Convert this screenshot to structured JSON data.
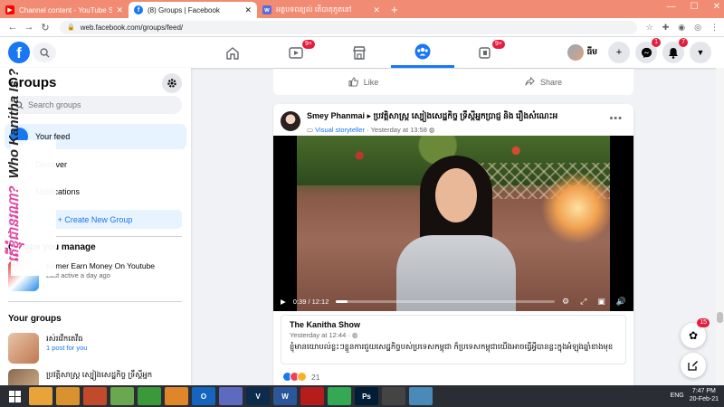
{
  "browser": {
    "tabs": [
      {
        "title": "Channel content - YouTube Studio",
        "fav_color": "#ff0000",
        "fav_glyph": "▶",
        "active": false
      },
      {
        "title": "(8) Groups | Facebook",
        "fav_color": "#1877f2",
        "fav_glyph": "f",
        "active": true
      },
      {
        "title": "អត្ថបទពន្យល់ តើបាតុភូតនៅ",
        "fav_color": "#5b6bd8",
        "fav_glyph": "w",
        "active": false
      }
    ],
    "new_tab": "+",
    "url": "web.facebook.com/groups/feed/"
  },
  "fbnav": {
    "logo": "f",
    "watch_badge": "9+",
    "gaming_badge": "9+",
    "profile_name": "ធីម",
    "messenger_badge": "1",
    "notifications_badge": "7"
  },
  "sidebar": {
    "title": "Groups",
    "search_placeholder": "Search groups",
    "items": [
      {
        "label": "Your feed",
        "active": true
      },
      {
        "label": "Discover",
        "active": false
      },
      {
        "label": "Notifications",
        "active": false
      }
    ],
    "create_label": "+ Create New Group",
    "manage_heading": "Groups you manage",
    "managed_group": {
      "name": "Khmer Earn Money On Youtube",
      "sub": "Last active a day ago"
    },
    "your_groups_heading": "Your groups",
    "your_groups": [
      {
        "name": "រស់រវើកតេវីធ",
        "sub": "1 post for you"
      },
      {
        "name": "ប្រវត្តិសាស្ត្រ ស្បៀងសេដ្ឋកិច្ច ទ្រឹស្ដីអ្នក",
        "sub": ""
      }
    ]
  },
  "overlay": {
    "khmer": "តើខ្ញុំជានរណា?",
    "english": "Who Kanitha Is ?"
  },
  "feed": {
    "prev_post": {
      "like": "Like",
      "share": "Share"
    },
    "post": {
      "author": "Smey Phanmai",
      "group": "ប្រវត្តិសាស្ត្រ ស្បៀងសេដ្ឋកិច្ច ទ្រឹស្ដីអ្នកប្រាជ្ញ និង រឿងសំណេះអ",
      "badge": "Visual storyteller",
      "time": "Yesterday at 13:58",
      "video": {
        "time": "0:39 / 12:12",
        "progress": 0.053
      },
      "link_card": {
        "title": "The Kanitha Show",
        "time": "Yesterday at 12:44",
        "body": "ខ្ញុំមានយោបល់ខ្លះៗខ្លួនការជួយសេដ្ឋកិច្ចបស់ប្រទេសកម្ពុជា ក៏ប្រទេសកម្ពុជាយើងអាចធ្វើអ្វីបានខ្លះក្នុងអំឡុងឆ្នាំខាងមុខ"
      },
      "reaction_count": "21"
    }
  },
  "floating": {
    "badge": "15"
  },
  "taskbar": {
    "apps": [
      {
        "label": "",
        "color": "#e8a33a"
      },
      {
        "label": "",
        "color": "#d9922e"
      },
      {
        "label": "",
        "color": "#c14a2a"
      },
      {
        "label": "",
        "color": "#6aa84f"
      },
      {
        "label": "",
        "color": "#3a9a3a"
      },
      {
        "label": "",
        "color": "#e0862a"
      },
      {
        "label": "O",
        "color": "#1565c0"
      },
      {
        "label": "",
        "color": "#5c6bc0"
      },
      {
        "label": "V",
        "color": "#0d2b4a"
      },
      {
        "label": "W",
        "color": "#2b579a"
      },
      {
        "label": "",
        "color": "#b71c1c"
      },
      {
        "label": "",
        "color": "#34a853"
      },
      {
        "label": "Ps",
        "color": "#001e36"
      },
      {
        "label": "",
        "color": "#444"
      },
      {
        "label": "",
        "color": "#4a8ab8"
      }
    ],
    "lang": "ENG",
    "time": "7:47 PM",
    "date": "20-Feb-21"
  }
}
